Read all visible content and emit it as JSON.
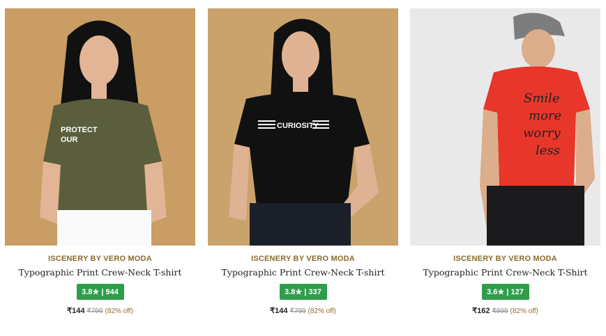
{
  "products": [
    {
      "brand": "ISCENERY BY VERO MODA",
      "name": "Typographic Print Crew-Neck T-shirt",
      "rating": "3.8",
      "reviews": "944",
      "price": "₹144",
      "mrp": "₹799",
      "discount": "(82% off)",
      "shirt_text": [
        "PROTECT",
        "OUR"
      ],
      "colors": {
        "bg": "#c99d63",
        "shirt": "#5b5e3c"
      }
    },
    {
      "brand": "ISCENERY BY VERO MODA",
      "name": "Typographic Print Crew-Neck T-shirt",
      "rating": "3.8",
      "reviews": "337",
      "price": "₹144",
      "mrp": "₹799",
      "discount": "(82% off)",
      "shirt_text": [
        "CURIOSITY"
      ],
      "colors": {
        "bg": "#c9a36b",
        "shirt": "#111111"
      }
    },
    {
      "brand": "ISCENERY BY VERO MODA",
      "name": "Typographic Print Crew-Neck T-Shirt",
      "rating": "3.6",
      "reviews": "127",
      "price": "₹162",
      "mrp": "₹899",
      "discount": "(82% off)",
      "shirt_text": [
        "Smile",
        "more",
        "worry",
        "less"
      ],
      "colors": {
        "bg": "#e9e9ea",
        "shirt": "#e8372a"
      }
    }
  ],
  "rating_star": "★",
  "rating_sep": "|"
}
